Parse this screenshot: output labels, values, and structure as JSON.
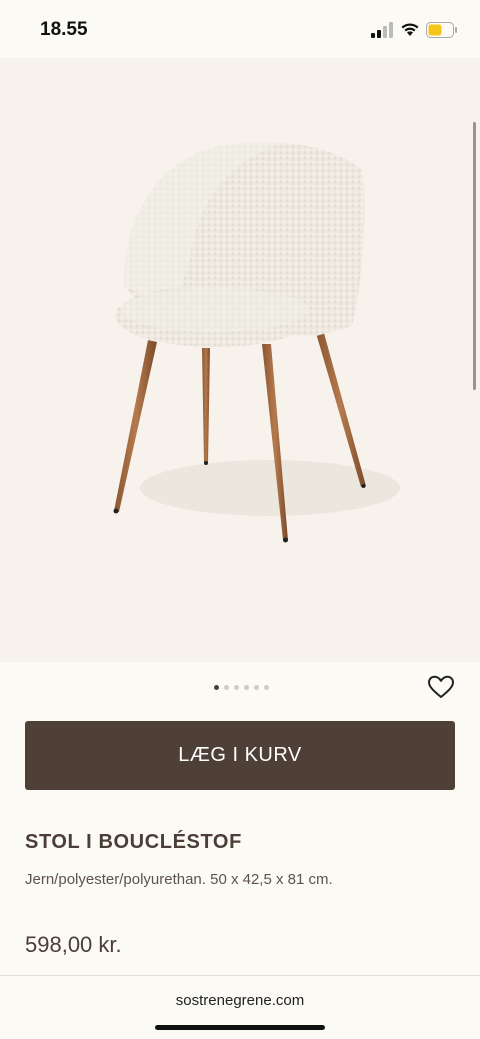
{
  "status_bar": {
    "time": "18.55"
  },
  "product": {
    "add_to_cart_label": "LÆG I KURV",
    "title": "STOL I BOUCLÉSTOF",
    "description": "Jern/polyester/polyurethan. 50 x 42,5 x 81 cm.",
    "price": "598,00 kr."
  },
  "carousel": {
    "dot_count": 6,
    "active_index": 0
  },
  "browser": {
    "url": "sostrenegrene.com"
  },
  "colors": {
    "button_bg": "#4e4037",
    "text_primary": "#4a3e36",
    "page_bg": "#fcfaf5",
    "image_bg": "#f7f3ec",
    "battery_fill": "#f5c518"
  },
  "icons": {
    "signal": "cellular-signal-icon",
    "wifi": "wifi-icon",
    "battery": "battery-icon",
    "wishlist": "heart-icon"
  }
}
